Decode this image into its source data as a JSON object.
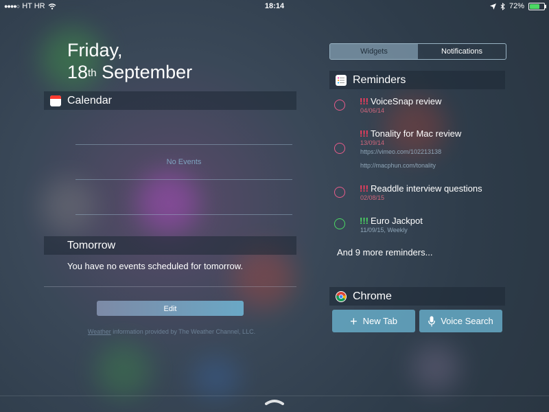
{
  "status_bar": {
    "carrier": "HT HR",
    "time": "18:14",
    "battery": "72%",
    "battery_level": 0.72
  },
  "date": {
    "weekday": "Friday,",
    "day": "18",
    "ordinal": "th",
    "month": "September"
  },
  "calendar": {
    "header": "Calendar",
    "no_events": "No Events"
  },
  "tomorrow": {
    "header": "Tomorrow",
    "text": "You have no events scheduled for tomorrow."
  },
  "edit_label": "Edit",
  "weather_credit": {
    "link": "Weather",
    "text": " information provided by The Weather Channel, LLC."
  },
  "tabs": [
    "Widgets",
    "Notifications"
  ],
  "reminders": {
    "header": "Reminders",
    "items": [
      {
        "priority": "!!!",
        "title": "VoiceSnap review",
        "date": "04/06/14",
        "color": "#e85c8a"
      },
      {
        "priority": "!!!",
        "title": "Tonality for Mac review",
        "date": "13/09/14",
        "url1": "https://vimeo.com/102213138",
        "url2": "http://macphun.com/tonality",
        "color": "#e85c8a"
      },
      {
        "priority": "!!!",
        "title": "Readdle interview questions",
        "date": "02/08/15",
        "color": "#e85c8a"
      },
      {
        "priority": "!!!",
        "title": "Euro Jackpot",
        "date": "11/09/15, Weekly",
        "color": "#4cd964"
      }
    ],
    "more": "And 9 more reminders..."
  },
  "chrome": {
    "header": "Chrome",
    "new_tab": "New Tab",
    "voice_search": "Voice Search"
  }
}
